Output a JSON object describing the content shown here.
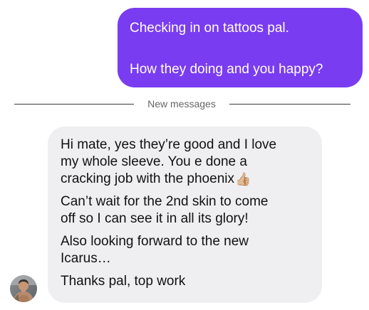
{
  "thread": {
    "outgoing": {
      "line1": "Checking in on tattoos pal.",
      "line2": "How they doing and you happy?",
      "bubble_color": "#7a3cf0"
    },
    "divider": {
      "label": "New messages"
    },
    "incoming": {
      "p1": {
        "l1": "Hi mate, yes they’re good and I love",
        "l2": "my whole sleeve. You e done a",
        "l3": "cracking job with the phoenix",
        "emoji": "👍🏼"
      },
      "p2": {
        "l1": "Can’t wait for the 2nd skin to come",
        "l2": "off so I can see it in all its glory!"
      },
      "p3": {
        "l1": "Also looking forward to the new",
        "l2": "Icarus…"
      },
      "p4": {
        "l1": "Thanks pal, top work"
      },
      "bubble_color": "#efeff1"
    },
    "avatar": {
      "icon": "profile-photo"
    }
  }
}
